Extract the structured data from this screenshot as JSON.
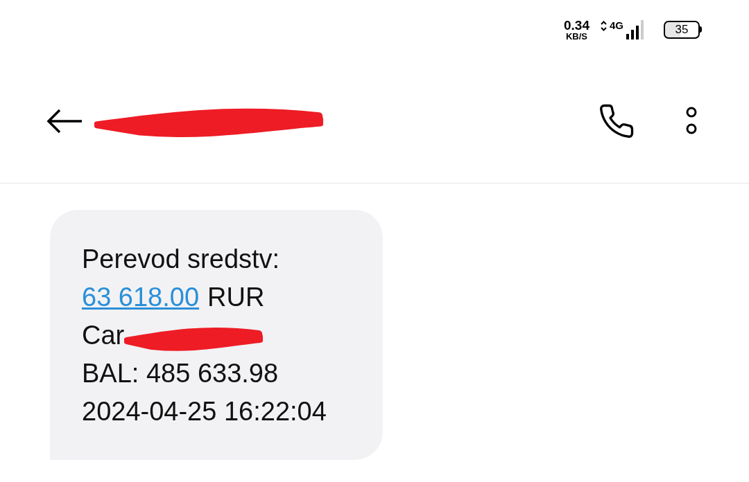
{
  "status_bar": {
    "speed": "0.34",
    "speed_unit": "KB/S",
    "network": "4G",
    "battery": "35"
  },
  "header": {
    "title_redacted": true
  },
  "message": {
    "lines": [
      {
        "kind": "text",
        "text": "Perevod sredstv:"
      },
      {
        "kind": "amount",
        "link": "63 618.00",
        "text": "RUR"
      },
      {
        "kind": "redacted",
        "text": "Car"
      },
      {
        "kind": "text",
        "text": "BAL: 485 633.98"
      },
      {
        "kind": "text",
        "text": "2024-04-25 16:22:04"
      }
    ]
  }
}
